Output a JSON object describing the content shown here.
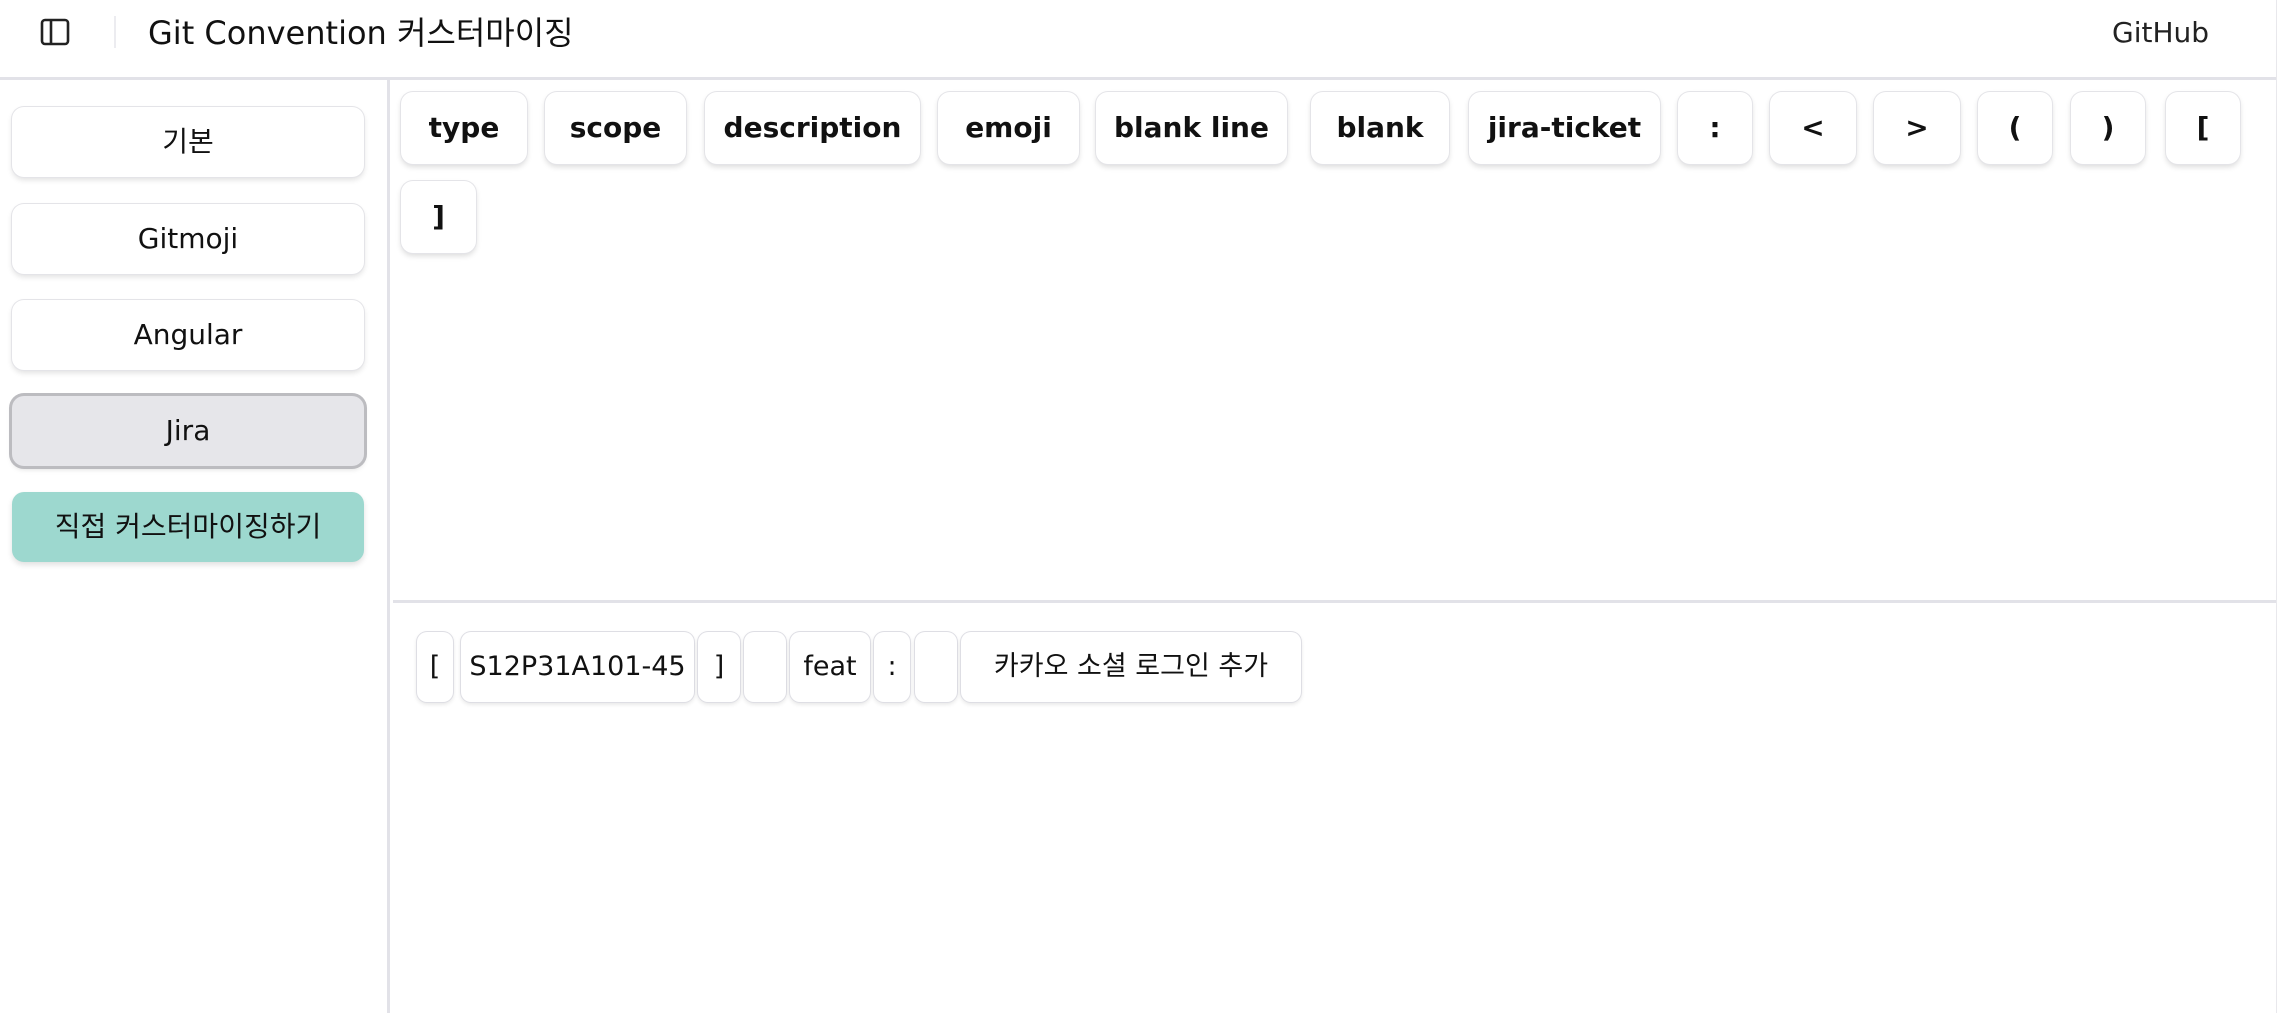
{
  "header": {
    "sidebar_toggle_icon": "sidebar-panel-icon",
    "title": "Git Convention 커스터마이징",
    "github_label": "GitHub"
  },
  "sidebar": {
    "items": [
      {
        "label": "기본",
        "state": "default"
      },
      {
        "label": "Gitmoji",
        "state": "default"
      },
      {
        "label": "Angular",
        "state": "default"
      },
      {
        "label": "Jira",
        "state": "selected"
      },
      {
        "label": "직접 커스터마이징하기",
        "state": "primary"
      }
    ],
    "accent_color": "#9dd8cf"
  },
  "palette": {
    "tokens": [
      "type",
      "scope",
      "description",
      "emoji",
      "blank line",
      "blank",
      "jira-ticket",
      ":",
      "<",
      ">",
      "(",
      ")",
      "[",
      "]"
    ]
  },
  "preview": {
    "chips": [
      "[",
      "S12P31A101-45",
      "]",
      "",
      "feat",
      ":",
      "",
      "카카오 소셜 로그인 추가"
    ]
  }
}
